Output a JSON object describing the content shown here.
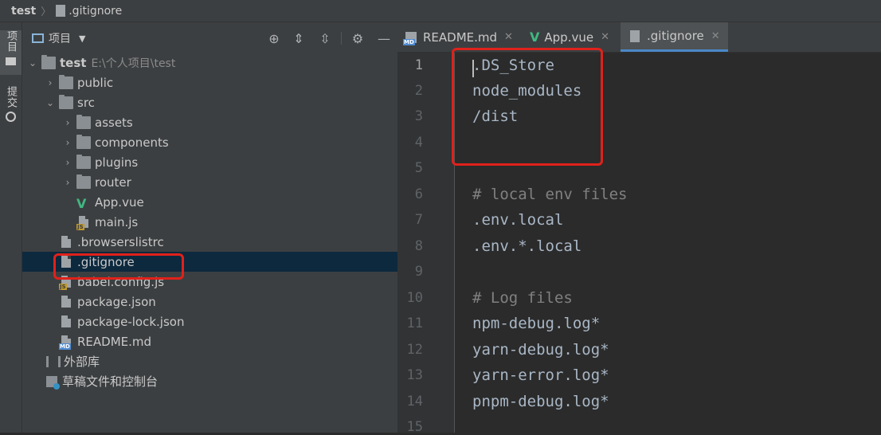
{
  "breadcrumb": {
    "project": "test",
    "file": ".gitignore"
  },
  "tool_strip": {
    "project_tab": "项目",
    "commit_tab": "提交"
  },
  "project_panel": {
    "title": "项目",
    "tree": [
      {
        "label": "test",
        "path": "E:\\个人项目\\test",
        "depth": 0,
        "expanded": true,
        "icon": "folder-icon"
      },
      {
        "label": "public",
        "depth": 1,
        "expanded": false,
        "icon": "folder-icon"
      },
      {
        "label": "src",
        "depth": 1,
        "expanded": true,
        "icon": "folder-icon"
      },
      {
        "label": "assets",
        "depth": 2,
        "expanded": false,
        "icon": "folder-icon"
      },
      {
        "label": "components",
        "depth": 2,
        "expanded": false,
        "icon": "folder-icon"
      },
      {
        "label": "plugins",
        "depth": 2,
        "expanded": false,
        "icon": "folder-icon"
      },
      {
        "label": "router",
        "depth": 2,
        "expanded": false,
        "icon": "folder-icon"
      },
      {
        "label": "App.vue",
        "depth": 2,
        "icon": "vue-file-icon"
      },
      {
        "label": "main.js",
        "depth": 2,
        "icon": "js-file-icon"
      },
      {
        "label": ".browserslistrc",
        "depth": 1,
        "icon": "text-file-icon"
      },
      {
        "label": ".gitignore",
        "depth": 1,
        "icon": "ignore-file-icon",
        "selected": true
      },
      {
        "label": "babel.config.js",
        "depth": 1,
        "icon": "js-file-icon"
      },
      {
        "label": "package.json",
        "depth": 1,
        "icon": "json-file-icon"
      },
      {
        "label": "package-lock.json",
        "depth": 1,
        "icon": "json-file-icon"
      },
      {
        "label": "README.md",
        "depth": 1,
        "icon": "md-file-icon"
      },
      {
        "label": "外部库",
        "depth": 0,
        "icon": "library-icon"
      },
      {
        "label": "草稿文件和控制台",
        "depth": 0,
        "icon": "scratch-icon"
      }
    ]
  },
  "editor_tabs": [
    {
      "label": "README.md",
      "icon": "md-file-icon",
      "active": false
    },
    {
      "label": "App.vue",
      "icon": "vue-file-icon",
      "active": false
    },
    {
      "label": ".gitignore",
      "icon": "ignore-file-icon",
      "active": true
    }
  ],
  "editor": {
    "line_numbers": [
      "1",
      "2",
      "3",
      "4",
      "5",
      "6",
      "7",
      "8",
      "9",
      "10",
      "11",
      "12",
      "13",
      "14",
      "15"
    ],
    "lines": [
      ".DS_Store",
      "node_modules",
      "/dist",
      "",
      "",
      "# local env files",
      ".env.local",
      ".env.*.local",
      "",
      "# Log files",
      "npm-debug.log*",
      "yarn-debug.log*",
      "yarn-error.log*",
      "pnpm-debug.log*",
      ""
    ]
  },
  "colors": {
    "highlight_box": "#e0211b",
    "selection": "#0d293e",
    "vue_green": "#41b883",
    "active_tab_underline": "#4a88c7"
  }
}
